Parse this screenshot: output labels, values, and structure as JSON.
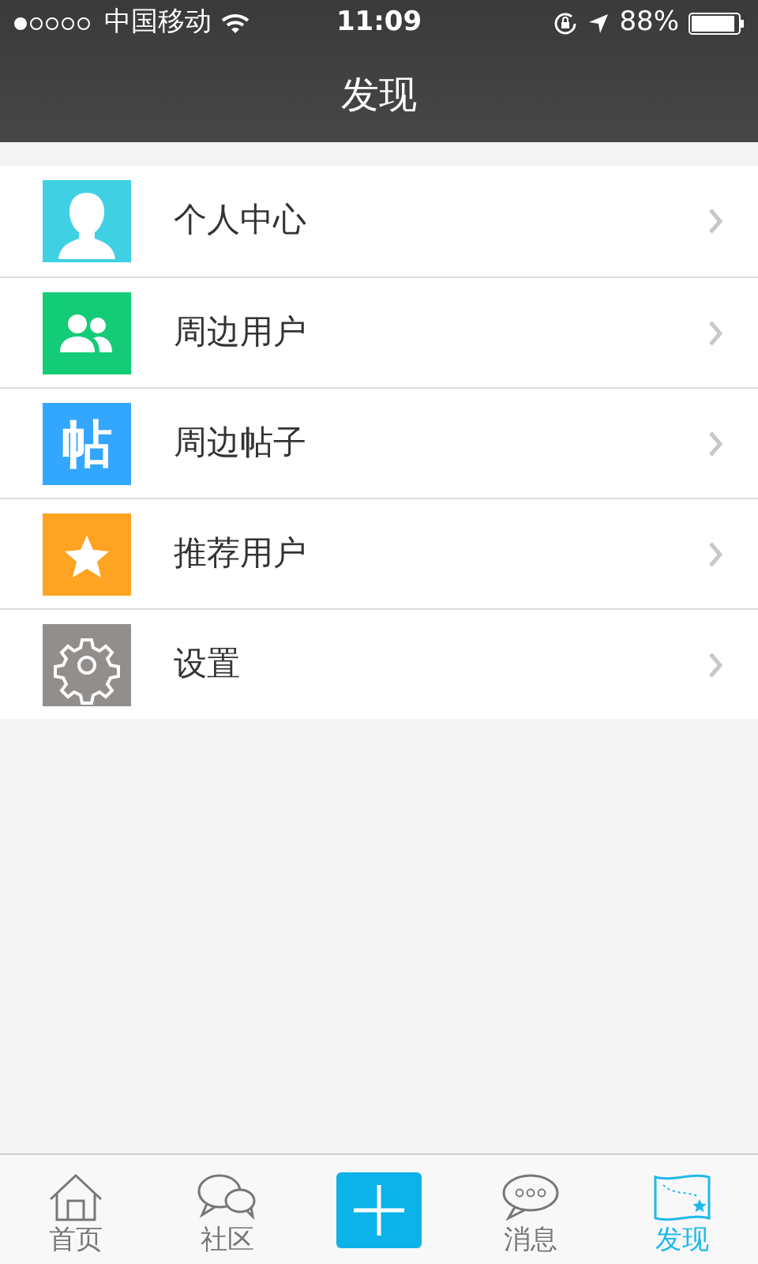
{
  "status_bar": {
    "carrier": "中国移动",
    "time": "11:09",
    "battery": "88%"
  },
  "nav_bar": {
    "title": "发现"
  },
  "menu": [
    {
      "kind": "person",
      "label": "个人中心",
      "color": "#40d0e4"
    },
    {
      "kind": "group",
      "label": "周边用户",
      "color": "#14cc78"
    },
    {
      "kind": "glyph",
      "glyph": "帖",
      "label": "周边帖子",
      "color": "#33a6ff"
    },
    {
      "kind": "star",
      "label": "推荐用户",
      "color": "#ffa322"
    },
    {
      "kind": "gear",
      "label": "设置",
      "color": "#928e8c"
    }
  ],
  "tab_bar": [
    {
      "kind": "home",
      "label": "首页",
      "selected": false
    },
    {
      "kind": "chat",
      "label": "社区",
      "selected": false
    },
    {
      "kind": "plus"
    },
    {
      "kind": "message",
      "label": "消息",
      "selected": false
    },
    {
      "kind": "map",
      "label": "发现",
      "selected": true
    }
  ]
}
